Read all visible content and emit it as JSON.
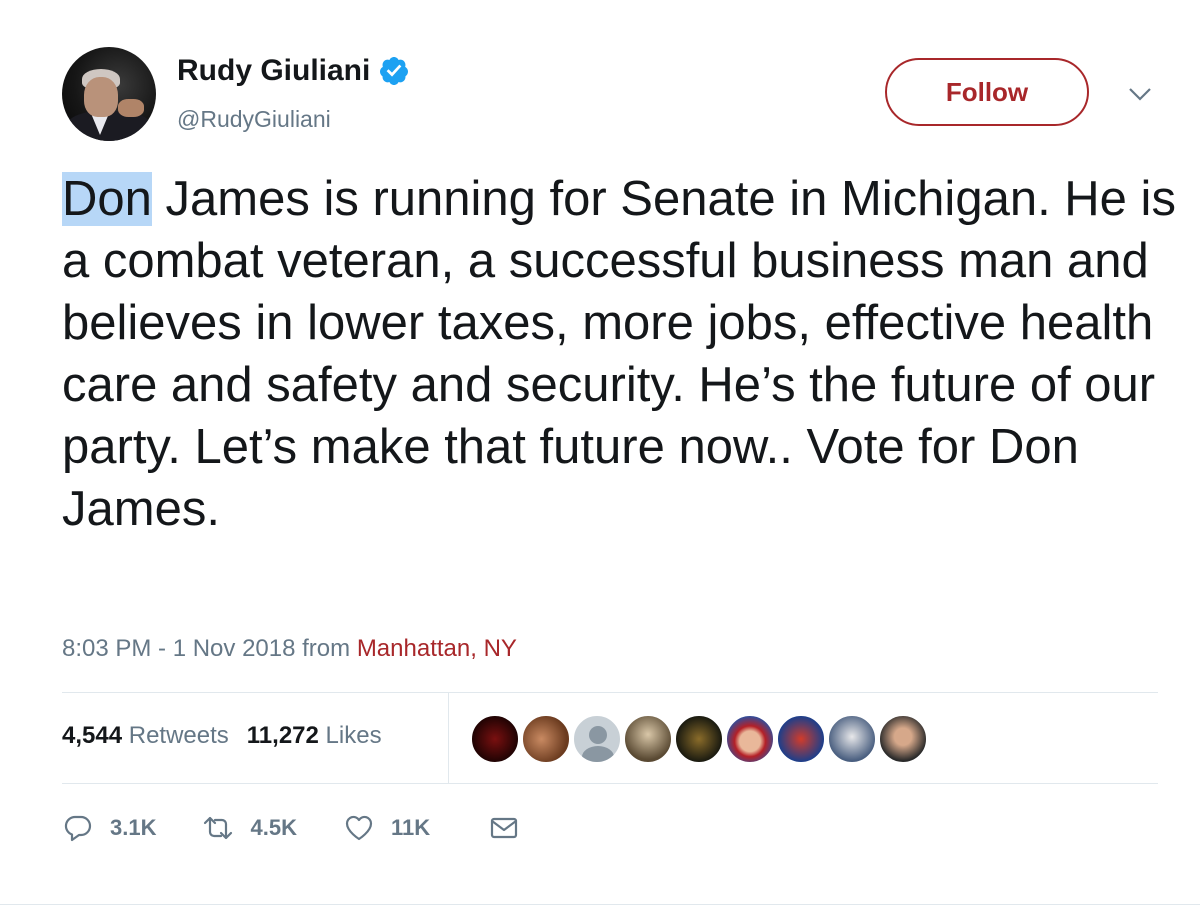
{
  "author": {
    "name": "Rudy Giuliani",
    "handle": "@RudyGiuliani",
    "verified": true
  },
  "follow_button": {
    "label": "Follow"
  },
  "tweet": {
    "highlighted_word": "Don",
    "text_rest": " James is running for Senate in Michigan. He is a combat veteran, a successful business man and believes in lower taxes, more jobs, effective health care and safety and security. He’s the future of our party. Let’s make that future now.. Vote for Don James."
  },
  "meta": {
    "time_date": "8:03 PM - 1 Nov 2018",
    "from_label": "from",
    "location": "Manhattan, NY"
  },
  "stats": {
    "retweets_count": "4,544",
    "retweets_label": "Retweets",
    "likes_count": "11,272",
    "likes_label": "Likes"
  },
  "liker_avatars": [
    "avatar-1",
    "avatar-2",
    "default-avatar",
    "avatar-4",
    "avatar-5",
    "avatar-6",
    "avatar-7",
    "avatar-8",
    "avatar-9"
  ],
  "actions": {
    "replies": "3.1K",
    "retweets": "4.5K",
    "likes": "11K"
  },
  "colors": {
    "accent": "#a8272a",
    "text": "#14171a",
    "secondary": "#657786",
    "verified": "#1da1f2",
    "highlight": "#b7d7f7"
  },
  "icons": [
    "verified-badge-icon",
    "chevron-down-icon",
    "reply-icon",
    "retweet-icon",
    "heart-icon",
    "direct-message-icon"
  ]
}
